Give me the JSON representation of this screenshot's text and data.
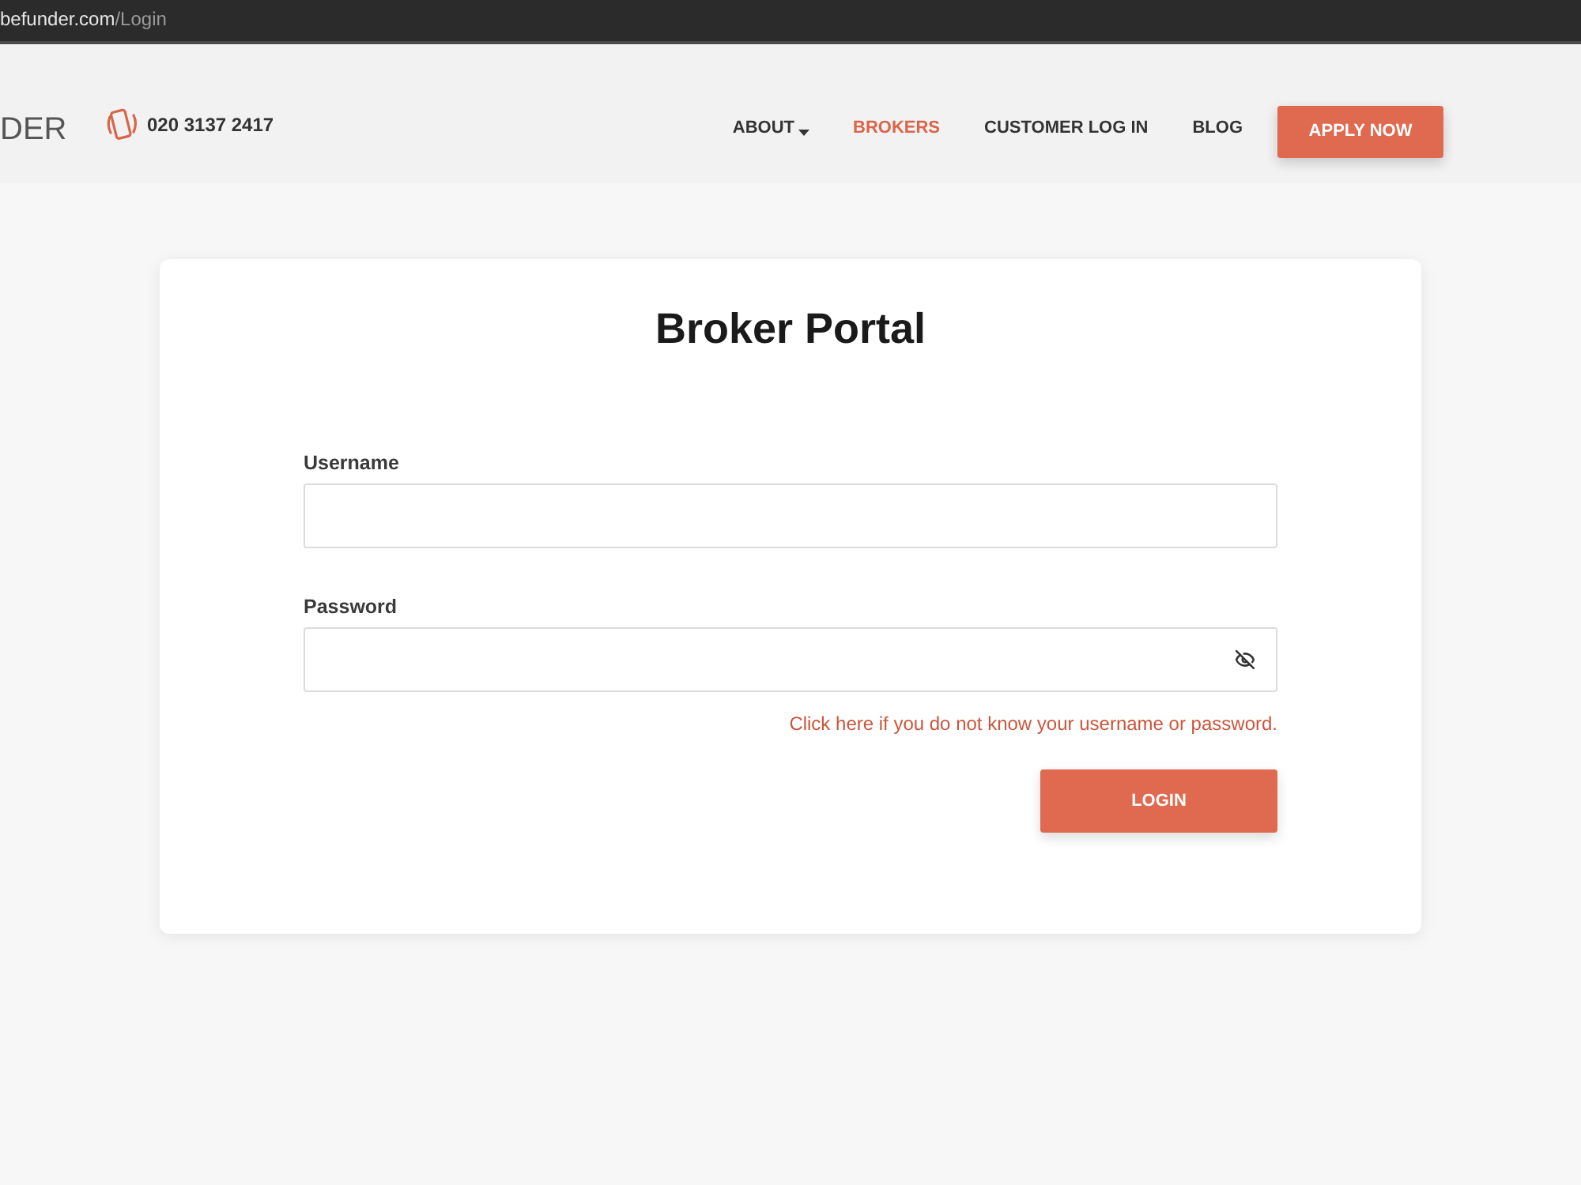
{
  "address_bar": {
    "host": "befunder.com",
    "path": "/Login"
  },
  "header": {
    "logo": "DER",
    "phone": "020 3137 2417",
    "nav": [
      {
        "label": "ABOUT",
        "selected": false,
        "dropdown": true
      },
      {
        "label": "BROKERS",
        "selected": true,
        "dropdown": false
      },
      {
        "label": "CUSTOMER LOG IN",
        "selected": false,
        "dropdown": false
      },
      {
        "label": "BLOG",
        "selected": false,
        "dropdown": false
      }
    ],
    "cta": "APPLY NOW"
  },
  "login": {
    "title": "Broker Portal",
    "fields": [
      {
        "label": "Username",
        "kind": "text"
      },
      {
        "label": "Password",
        "kind": "password"
      }
    ],
    "forgot_link": "Click here if you do not know your username or password.",
    "submit": "LOGIN"
  }
}
